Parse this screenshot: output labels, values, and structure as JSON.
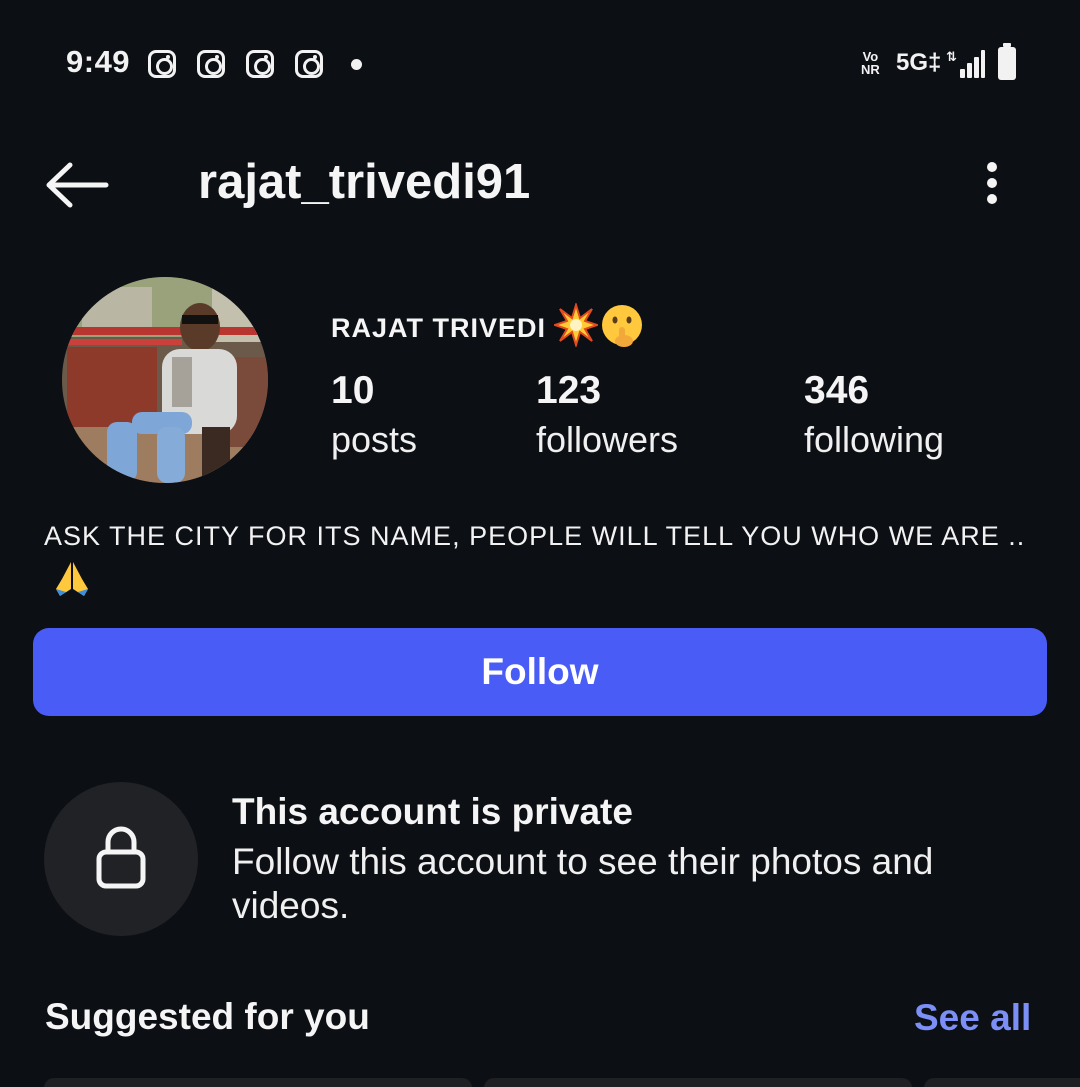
{
  "status_bar": {
    "time": "9:49",
    "notification_icons": [
      "instagram-icon",
      "instagram-icon",
      "instagram-icon",
      "instagram-icon"
    ],
    "vonr_top": "Vo",
    "vonr_bottom": "NR",
    "network": "5G‡",
    "signal_level": 4,
    "battery_level": 1.0
  },
  "header": {
    "username": "rajat_trivedi91",
    "back_icon": "arrow-left-icon",
    "more_icon": "vertical-dots-icon"
  },
  "profile": {
    "display_name": "RAJAT TRIVEDI",
    "name_emojis": [
      "💥",
      "🤫"
    ],
    "stats": [
      {
        "value": "10",
        "label": "posts"
      },
      {
        "value": "123",
        "label": "followers"
      },
      {
        "value": "346",
        "label": "following"
      }
    ],
    "bio_text": "ASK THE CITY FOR ITS NAME, PEOPLE WILL TELL YOU WHO WE ARE ..",
    "bio_emoji": "🙏"
  },
  "follow_button": {
    "label": "Follow"
  },
  "private_notice": {
    "icon": "lock-icon",
    "title": "This account is private",
    "description": "Follow this account to see their photos and videos."
  },
  "suggested": {
    "title": "Suggested for you",
    "see_all": "See all"
  },
  "colors": {
    "background": "#0c0f14",
    "accent": "#4a5cf6",
    "link": "#7b8ff6",
    "badge_bg": "#202226"
  }
}
